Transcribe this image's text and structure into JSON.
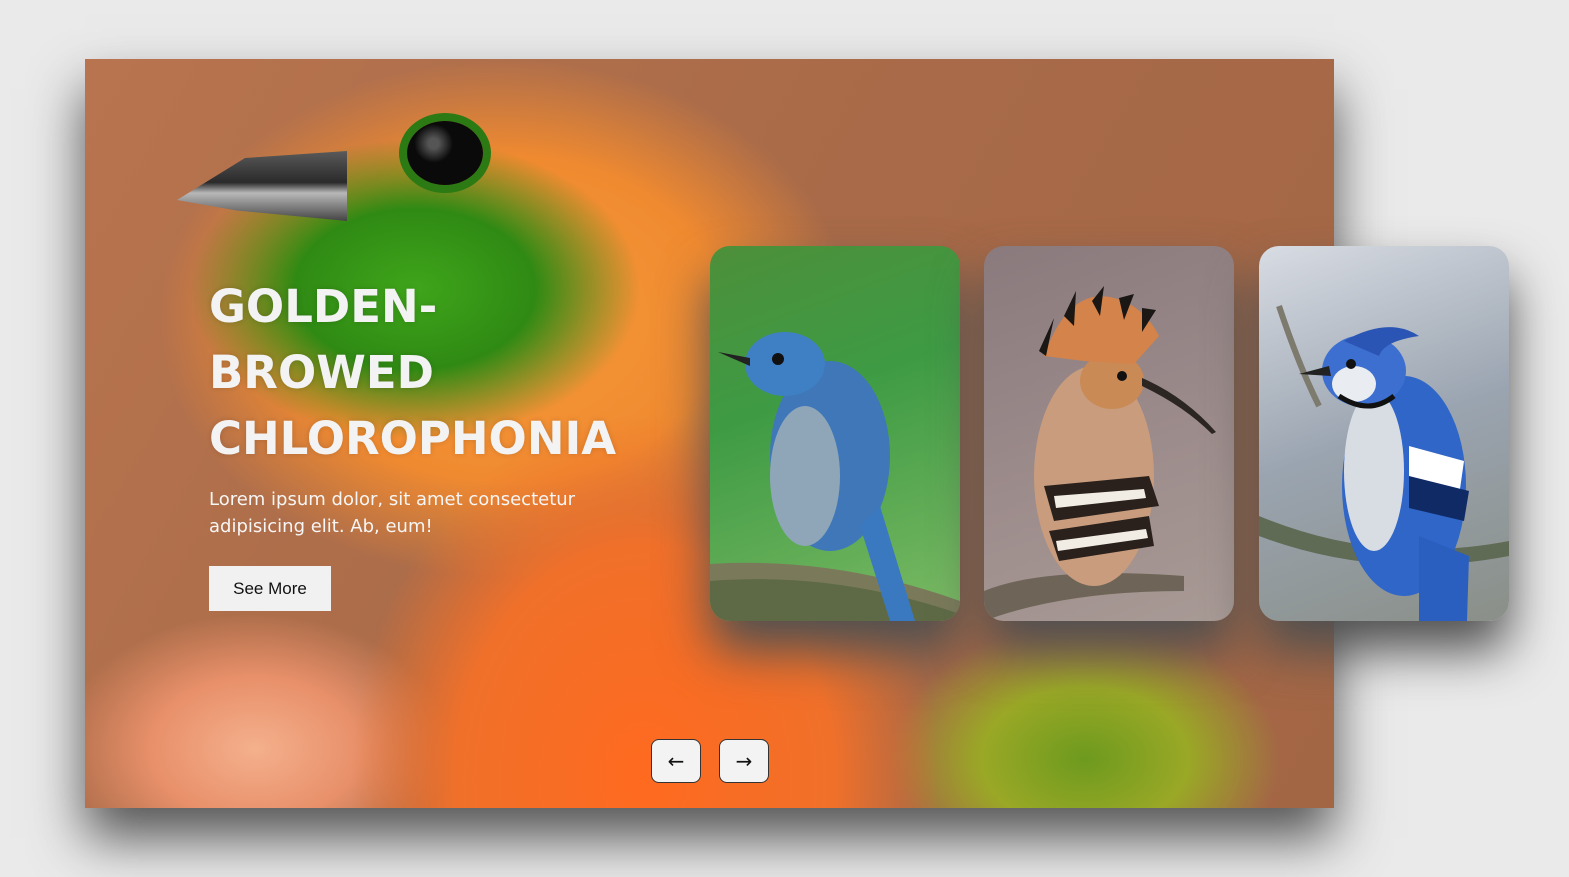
{
  "hero": {
    "title": "GOLDEN-BROWED CHLOROPHONIA",
    "description": "Lorem ipsum dolor, sit amet consectetur adipisicing elit. Ab, eum!",
    "button_label": "See More"
  },
  "cards": [
    {
      "icon": "blue-flycatcher-image"
    },
    {
      "icon": "hoopoe-image"
    },
    {
      "icon": "blue-jay-image"
    }
  ],
  "nav": {
    "prev_icon": "←",
    "next_icon": "→"
  },
  "colors": {
    "background": "#eaeaea",
    "button_bg": "#f1f1f1",
    "text": "#ffffff"
  }
}
